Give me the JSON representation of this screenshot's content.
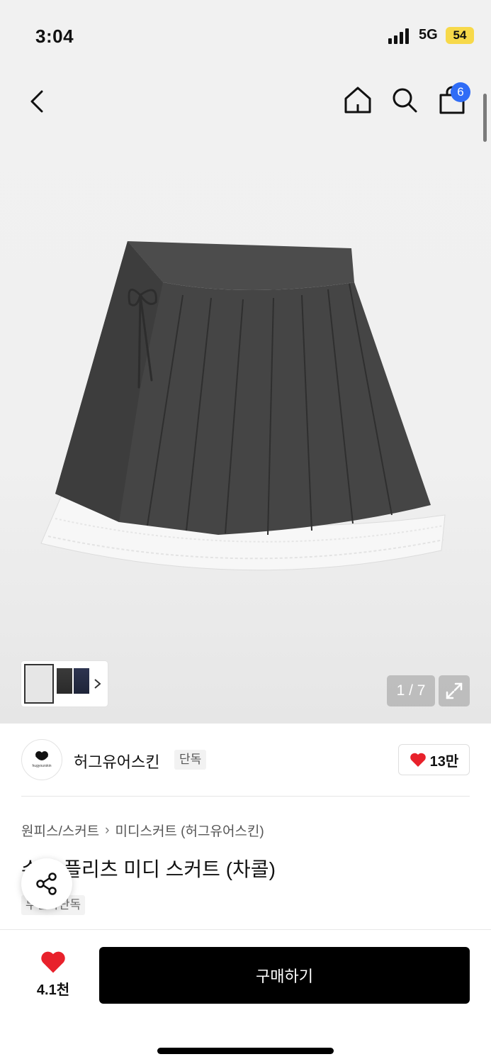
{
  "status_bar": {
    "time": "3:04",
    "network": "5G",
    "battery": "54"
  },
  "header": {
    "cart_count": "6"
  },
  "gallery": {
    "counter": "1 / 7"
  },
  "brand": {
    "logo_text": "hugyourskin",
    "name": "허그유어스킨",
    "exclusive_tag": "단독",
    "like_count": "13만"
  },
  "product": {
    "breadcrumb": [
      "원피스/스커트",
      "미디스커트 (허그유어스킨)"
    ],
    "title": "슈가 플리츠 미디 스커트 (차콜)",
    "member_tag": "무신사단독"
  },
  "bottom_bar": {
    "wish_count": "4.1천",
    "buy_label": "구매하기"
  },
  "colors": {
    "accent_red": "#e8212b",
    "badge_blue": "#2f6cf6",
    "battery_yellow": "#f7d94a"
  }
}
